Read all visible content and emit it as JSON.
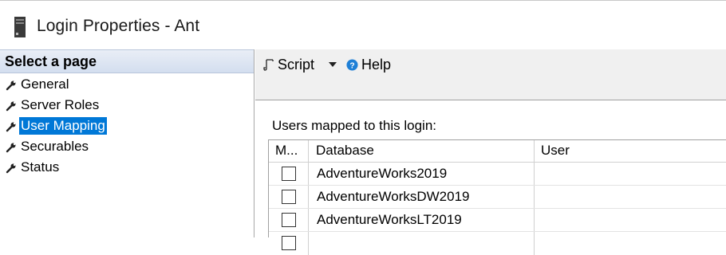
{
  "window": {
    "title": "Login Properties - Ant",
    "icon": "server-icon"
  },
  "left_pane": {
    "header": "Select a page",
    "items": [
      {
        "label": "General",
        "icon": "wrench-icon",
        "selected": false
      },
      {
        "label": "Server Roles",
        "icon": "wrench-icon",
        "selected": false
      },
      {
        "label": "User Mapping",
        "icon": "wrench-icon",
        "selected": true
      },
      {
        "label": "Securables",
        "icon": "wrench-icon",
        "selected": false
      },
      {
        "label": "Status",
        "icon": "wrench-icon",
        "selected": false
      }
    ],
    "selected_color": "#0078d7"
  },
  "toolbar": {
    "script_label": "Script",
    "help_label": "Help"
  },
  "mapping": {
    "section_label": "Users mapped to this login:",
    "columns": [
      "M...",
      "Database",
      "User"
    ],
    "rows": [
      {
        "map": false,
        "database": "AdventureWorks2019",
        "user": ""
      },
      {
        "map": false,
        "database": "AdventureWorksDW2019",
        "user": ""
      },
      {
        "map": false,
        "database": "AdventureWorksLT2019",
        "user": ""
      }
    ]
  }
}
